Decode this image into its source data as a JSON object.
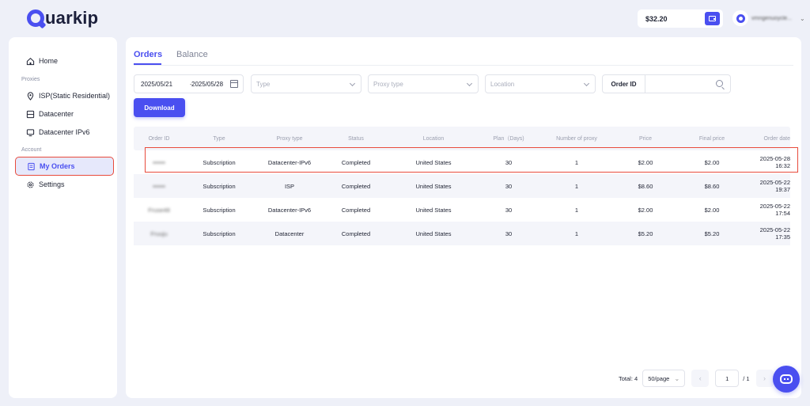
{
  "brand": {
    "logo_text": "uarkip"
  },
  "header": {
    "balance": "$32.20",
    "username": "vmngenuoycle..."
  },
  "sidebar": {
    "items_top": [
      {
        "label": "Home"
      }
    ],
    "section_proxies": "Proxies",
    "items_proxies": [
      {
        "label": "ISP(Static Residential)"
      },
      {
        "label": "Datacenter"
      },
      {
        "label": "Datacenter IPv6"
      }
    ],
    "section_account": "Account",
    "items_account": [
      {
        "label": "My Orders",
        "active": true
      },
      {
        "label": "Settings"
      }
    ]
  },
  "tabs": [
    {
      "label": "Orders",
      "active": true
    },
    {
      "label": "Balance",
      "active": false
    }
  ],
  "filters": {
    "date_start": "2025/05/21",
    "date_sep": "-",
    "date_end": "2025/05/28",
    "type_placeholder": "Type",
    "proxy_type_placeholder": "Proxy type",
    "location_placeholder": "Location",
    "order_id_label": "Order ID"
  },
  "download_label": "Download",
  "table": {
    "headers": [
      "Order ID",
      "Type",
      "Proxy type",
      "Status",
      "Location",
      "Plan（Days)",
      "Number of proxy",
      "Price",
      "Final price",
      "Order date"
    ],
    "rows": [
      [
        "••••••",
        "Subscription",
        "Datacenter-IPv6",
        "Completed",
        "United States",
        "30",
        "1",
        "$2.00",
        "$2.00",
        "2025-05-28 16:32"
      ],
      [
        "••••••",
        "Subscription",
        "ISP",
        "Completed",
        "United States",
        "30",
        "1",
        "$8.60",
        "$8.60",
        "2025-05-22 19:37"
      ],
      [
        "Fruse48",
        "Subscription",
        "Datacenter-IPv6",
        "Completed",
        "United States",
        "30",
        "1",
        "$2.00",
        "$2.00",
        "2025-05-22 17:54"
      ],
      [
        "Fruuju",
        "Subscription",
        "Datacenter",
        "Completed",
        "United States",
        "30",
        "1",
        "$5.20",
        "$5.20",
        "2025-05-22 17:35"
      ]
    ]
  },
  "pagination": {
    "total": "Total: 4",
    "per_page": "50/page",
    "page": "1",
    "of": "/ 1",
    "prev": "‹",
    "next": "›"
  },
  "colors": {
    "accent": "#4a4ff0",
    "highlight": "#e84b3c"
  }
}
